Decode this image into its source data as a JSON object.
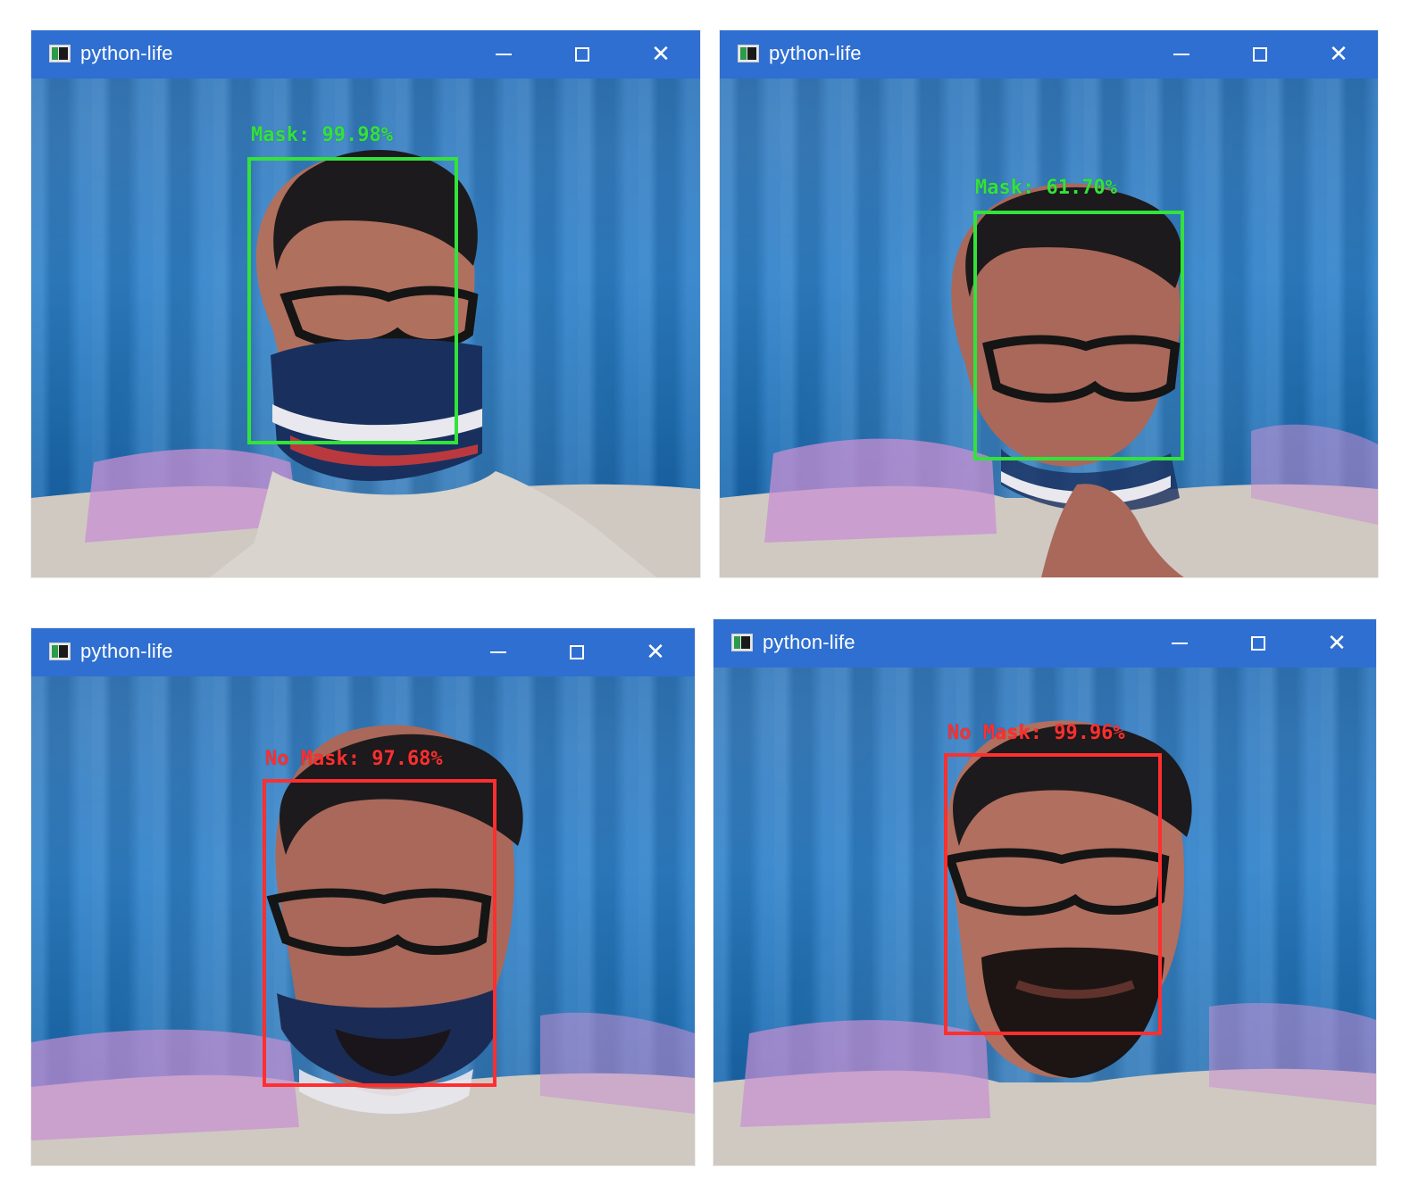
{
  "windows": [
    {
      "title": "python-life",
      "controls": {
        "minimize": "minimize-icon",
        "maximize": "maximize-icon",
        "close": "close-icon"
      },
      "detection": {
        "label": "Mask: 99.98%",
        "status": "mask",
        "color": "#33e23a"
      }
    },
    {
      "title": "python-life",
      "controls": {
        "minimize": "minimize-icon",
        "maximize": "maximize-icon",
        "close": "close-icon"
      },
      "detection": {
        "label": "Mask: 61.70%",
        "status": "mask",
        "color": "#33e23a"
      }
    },
    {
      "title": "python-life",
      "controls": {
        "minimize": "minimize-icon",
        "maximize": "maximize-icon",
        "close": "close-icon"
      },
      "detection": {
        "label": "No Mask: 97.68%",
        "status": "no-mask",
        "color": "#ff2f2f"
      }
    },
    {
      "title": "python-life",
      "controls": {
        "minimize": "minimize-icon",
        "maximize": "maximize-icon",
        "close": "close-icon"
      },
      "detection": {
        "label": "No Mask: 99.96%",
        "status": "no-mask",
        "color": "#ff2f2f"
      }
    }
  ],
  "colors": {
    "titlebar": "#2f6fd1",
    "mask_box": "#33e23a",
    "no_mask_box": "#ff2f2f"
  }
}
